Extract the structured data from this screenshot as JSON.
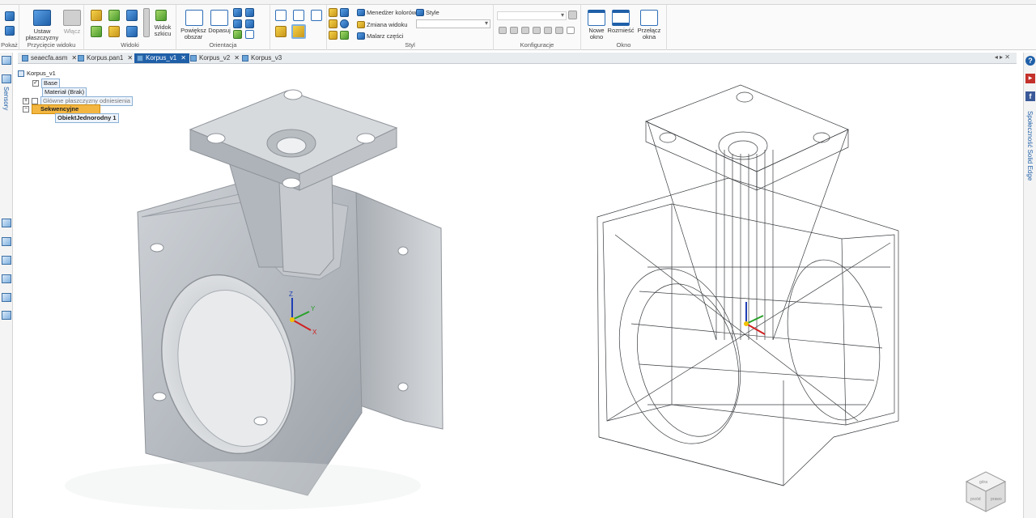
{
  "ribbon": {
    "groups": [
      {
        "name": "Pokaż",
        "buttons": []
      },
      {
        "name": "Przycięcie widoku",
        "buttons": [
          "Ustaw płaszczyzny",
          "Włącz"
        ]
      },
      {
        "name": "Widoki",
        "buttons": [
          "Widok szkicu"
        ]
      },
      {
        "name": "Orientacja",
        "buttons": [
          "Powiększ obszar",
          "Dopasuj"
        ]
      },
      {
        "name": "Styl",
        "buttons": [
          "Menedżer kolorów",
          "Zmiana widoku",
          "Malarz części",
          "Style"
        ]
      },
      {
        "name": "Konfiguracje",
        "buttons": []
      },
      {
        "name": "Okno",
        "buttons": [
          "Nowe okno",
          "Rozmieść",
          "Przełącz okna"
        ]
      }
    ]
  },
  "doc_tabs": [
    {
      "label": "seaecfa.asm",
      "active": false
    },
    {
      "label": "Korpus.pan1",
      "active": false
    },
    {
      "label": "Korpus_v1",
      "active": true
    },
    {
      "label": "Korpus_v2",
      "active": false
    },
    {
      "label": "Korpus_v3",
      "active": false
    }
  ],
  "left_panel": {
    "label": "Sensory"
  },
  "right_panel": {
    "label": "Społeczność Solid Edge"
  },
  "tree": {
    "root": "Korpus_v1",
    "items": [
      "Base",
      "Materiał (Brak)",
      "Główne płaszczyzny odniesienia",
      "Sekwencyjne",
      "ObiektJednorodny 1"
    ]
  },
  "triad": {
    "x": "X",
    "y": "Y",
    "z": "Z"
  },
  "viewcube": {
    "faces": [
      "góra",
      "przód",
      "prawo"
    ]
  },
  "colors": {
    "accent": "#1f5fa8",
    "sequential_highlight": "#f3b640",
    "model_shaded": "#b9bec4"
  }
}
